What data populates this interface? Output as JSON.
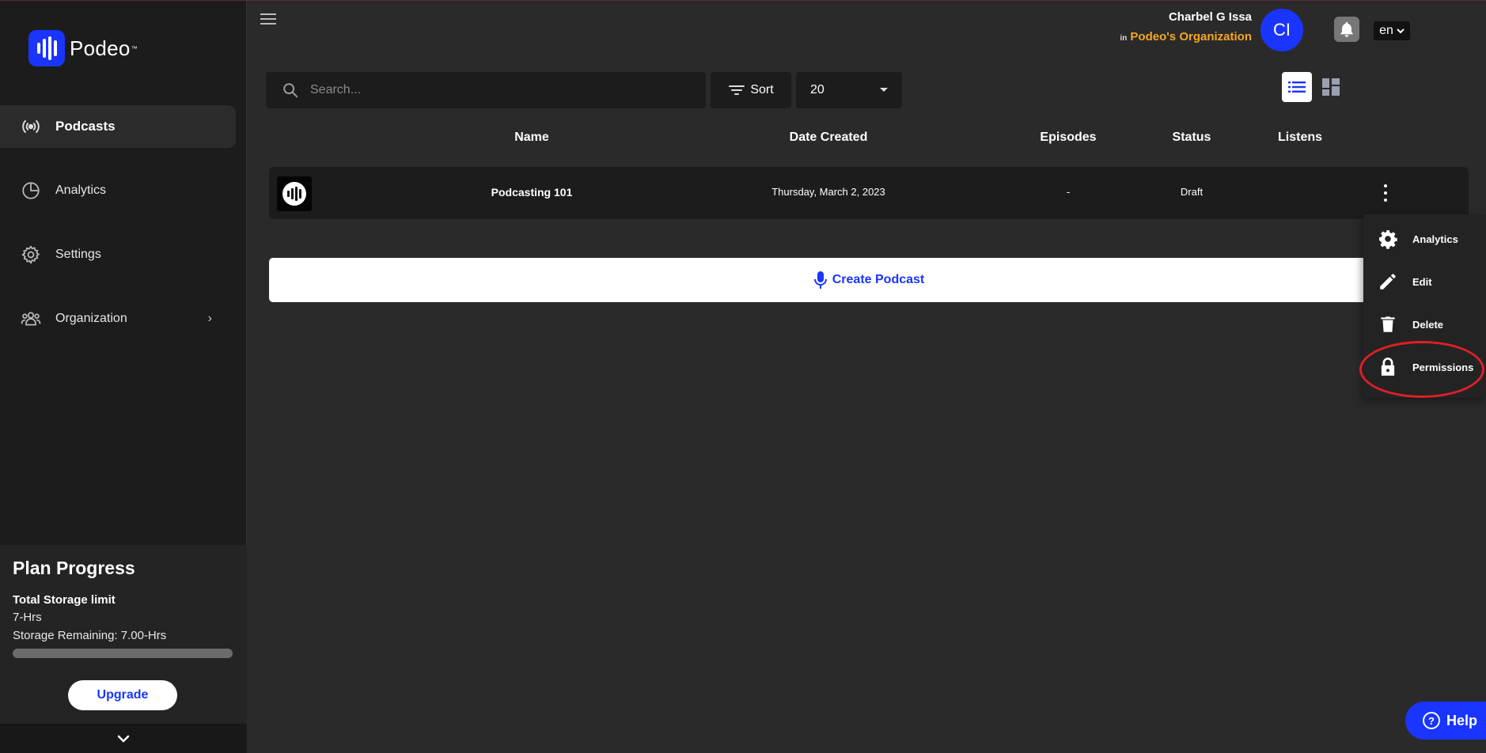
{
  "brand": {
    "name": "Podeo",
    "tm": "™"
  },
  "sidebar": {
    "items": [
      {
        "label": "Podcasts",
        "icon": "broadcast-icon",
        "active": true
      },
      {
        "label": "Analytics",
        "icon": "pie-chart-icon"
      },
      {
        "label": "Settings",
        "icon": "gear-icon"
      },
      {
        "label": "Organization",
        "icon": "people-icon",
        "has_submenu": true
      }
    ]
  },
  "plan": {
    "title": "Plan Progress",
    "limit_label": "Total Storage limit",
    "limit_value": "7-Hrs",
    "remaining": "Storage Remaining: 7.00-Hrs",
    "used_fraction": 0,
    "upgrade_label": "Upgrade"
  },
  "header": {
    "user_name": "Charbel G Issa",
    "in_label": "in",
    "org_name": "Podeo's Organization",
    "avatar_initials": "CI",
    "language": "en"
  },
  "toolbar": {
    "search_placeholder": "Search...",
    "sort_label": "Sort",
    "per_page": "20"
  },
  "table": {
    "columns": [
      "Name",
      "Date Created",
      "Episodes",
      "Status",
      "Listens"
    ],
    "rows": [
      {
        "name": "Podcasting 101",
        "date": "Thursday, March 2, 2023",
        "episodes": "-",
        "status": "Draft",
        "listens": ""
      }
    ]
  },
  "create_label": "Create Podcast",
  "menu": {
    "items": [
      {
        "label": "Analytics",
        "icon": "gear-icon"
      },
      {
        "label": "Edit",
        "icon": "pencil-icon"
      },
      {
        "label": "Delete",
        "icon": "trash-icon"
      },
      {
        "label": "Permissions",
        "icon": "lock-icon"
      }
    ]
  },
  "help_label": "Help",
  "colors": {
    "accent": "#1a35ff",
    "org": "#f5a623",
    "highlight": "#e01e2a"
  }
}
